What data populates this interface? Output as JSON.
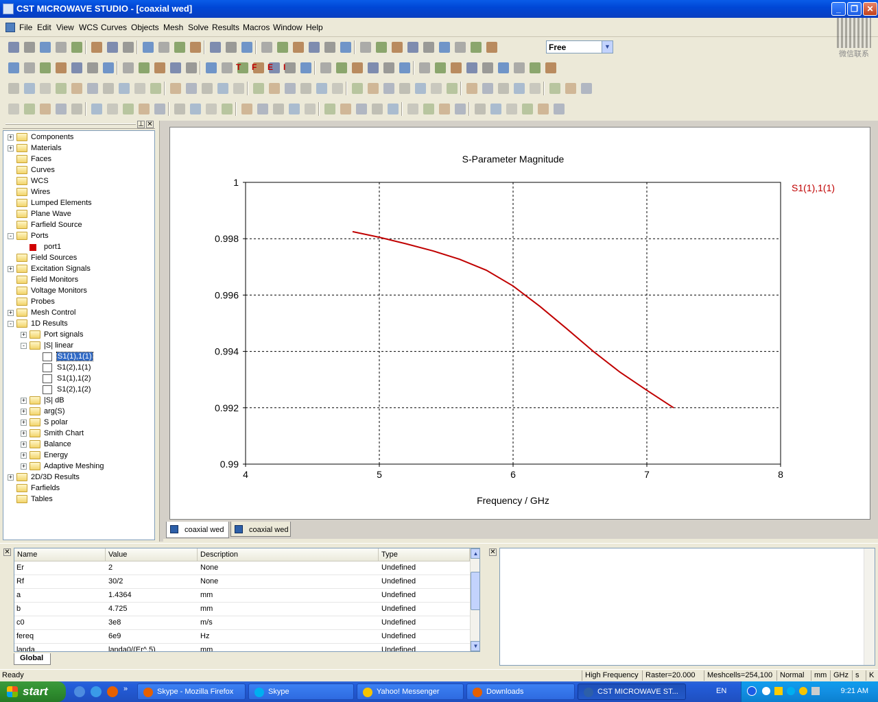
{
  "window": {
    "title": "CST MICROWAVE STUDIO - [coaxial wed]",
    "caption_buttons": [
      "minimize",
      "restore",
      "close"
    ]
  },
  "menu": [
    "File",
    "Edit",
    "View",
    "WCS",
    "Curves",
    "Objects",
    "Mesh",
    "Solve",
    "Results",
    "Macros",
    "Window",
    "Help"
  ],
  "toolbar": {
    "mode_select": "Free",
    "special_labels": [
      "T",
      "F",
      "E",
      "I"
    ]
  },
  "watermark": {
    "text": "微信联系"
  },
  "tree": [
    {
      "label": "Components",
      "level": 0,
      "toggle": "+",
      "icon": "folder"
    },
    {
      "label": "Materials",
      "level": 0,
      "toggle": "+",
      "icon": "folder"
    },
    {
      "label": "Faces",
      "level": 0,
      "toggle": "",
      "icon": "folder"
    },
    {
      "label": "Curves",
      "level": 0,
      "toggle": "",
      "icon": "folder"
    },
    {
      "label": "WCS",
      "level": 0,
      "toggle": "",
      "icon": "folder"
    },
    {
      "label": "Wires",
      "level": 0,
      "toggle": "",
      "icon": "folder"
    },
    {
      "label": "Lumped Elements",
      "level": 0,
      "toggle": "",
      "icon": "folder"
    },
    {
      "label": "Plane Wave",
      "level": 0,
      "toggle": "",
      "icon": "folder"
    },
    {
      "label": "Farfield Source",
      "level": 0,
      "toggle": "",
      "icon": "folder"
    },
    {
      "label": "Ports",
      "level": 0,
      "toggle": "-",
      "icon": "folder"
    },
    {
      "label": "port1",
      "level": 1,
      "toggle": "",
      "icon": "port"
    },
    {
      "label": "Field Sources",
      "level": 0,
      "toggle": "",
      "icon": "folder"
    },
    {
      "label": "Excitation Signals",
      "level": 0,
      "toggle": "+",
      "icon": "folder"
    },
    {
      "label": "Field Monitors",
      "level": 0,
      "toggle": "",
      "icon": "folder"
    },
    {
      "label": "Voltage Monitors",
      "level": 0,
      "toggle": "",
      "icon": "folder"
    },
    {
      "label": "Probes",
      "level": 0,
      "toggle": "",
      "icon": "folder"
    },
    {
      "label": "Mesh Control",
      "level": 0,
      "toggle": "+",
      "icon": "folder"
    },
    {
      "label": "1D Results",
      "level": 0,
      "toggle": "-",
      "icon": "folder"
    },
    {
      "label": "Port signals",
      "level": 1,
      "toggle": "+",
      "icon": "folder"
    },
    {
      "label": "|S| linear",
      "level": 1,
      "toggle": "-",
      "icon": "folder"
    },
    {
      "label": "S1(1),1(1)",
      "level": 2,
      "toggle": "",
      "icon": "leaf",
      "selected": true
    },
    {
      "label": "S1(2),1(1)",
      "level": 2,
      "toggle": "",
      "icon": "leaf"
    },
    {
      "label": "S1(1),1(2)",
      "level": 2,
      "toggle": "",
      "icon": "leaf"
    },
    {
      "label": "S1(2),1(2)",
      "level": 2,
      "toggle": "",
      "icon": "leaf"
    },
    {
      "label": "|S| dB",
      "level": 1,
      "toggle": "+",
      "icon": "folder"
    },
    {
      "label": "arg(S)",
      "level": 1,
      "toggle": "+",
      "icon": "folder"
    },
    {
      "label": "S polar",
      "level": 1,
      "toggle": "+",
      "icon": "folder"
    },
    {
      "label": "Smith Chart",
      "level": 1,
      "toggle": "+",
      "icon": "folder"
    },
    {
      "label": "Balance",
      "level": 1,
      "toggle": "+",
      "icon": "folder"
    },
    {
      "label": "Energy",
      "level": 1,
      "toggle": "+",
      "icon": "folder"
    },
    {
      "label": "Adaptive Meshing",
      "level": 1,
      "toggle": "+",
      "icon": "folder"
    },
    {
      "label": "2D/3D Results",
      "level": 0,
      "toggle": "+",
      "icon": "folder"
    },
    {
      "label": "Farfields",
      "level": 0,
      "toggle": "",
      "icon": "folder"
    },
    {
      "label": "Tables",
      "level": 0,
      "toggle": "",
      "icon": "folder"
    }
  ],
  "chart_data": {
    "type": "line",
    "title": "S-Parameter Magnitude",
    "xlabel": "Frequency / GHz",
    "ylabel": "",
    "xlim": [
      4,
      8
    ],
    "ylim": [
      0.99,
      1
    ],
    "xticks": [
      "4",
      "5",
      "6",
      "7",
      "8"
    ],
    "yticks": [
      "0.99",
      "0.992",
      "0.994",
      "0.996",
      "0.998",
      "1"
    ],
    "grid": true,
    "legend_position": "right",
    "series": [
      {
        "name": "S1(1),1(1)",
        "color": "#c00000",
        "x": [
          4.8,
          5.0,
          5.2,
          5.4,
          5.6,
          5.8,
          6.0,
          6.2,
          6.4,
          6.6,
          6.8,
          7.0,
          7.2
        ],
        "y": [
          0.99825,
          0.99805,
          0.99782,
          0.99757,
          0.99727,
          0.99688,
          0.99632,
          0.9956,
          0.99481,
          0.994,
          0.99326,
          0.99262,
          0.992
        ]
      }
    ]
  },
  "chart_tabs": [
    {
      "label": "coaxial wed",
      "active": true
    },
    {
      "label": "coaxial wed",
      "active": false
    }
  ],
  "parameters": {
    "columns": [
      "Name",
      "Value",
      "Description",
      "Type"
    ],
    "rows": [
      [
        "Er",
        "2",
        "None",
        "Undefined"
      ],
      [
        "Rf",
        "30/2",
        "None",
        "Undefined"
      ],
      [
        "a",
        "1.4364",
        "mm",
        "Undefined"
      ],
      [
        "b",
        "4.725",
        "mm",
        "Undefined"
      ],
      [
        "c0",
        "3e8",
        "m/s",
        "Undefined"
      ],
      [
        "fereq",
        "6e9",
        "Hz",
        "Undefined"
      ],
      [
        "landa",
        "landa0/(Er^.5)",
        "mm",
        "Undefined"
      ]
    ],
    "tab": "Global"
  },
  "status": {
    "ready": "Ready",
    "solver": "High Frequency",
    "raster": "Raster=20.000",
    "meshcells": "Meshcells=254,100",
    "mode": "Normal",
    "length_unit": "mm",
    "freq_unit": "GHz",
    "time_unit": "s",
    "temp_unit": "K"
  },
  "taskbar": {
    "start": "start",
    "tasks": [
      {
        "label": "Skype - Mozilla Firefox",
        "color": "#e66000"
      },
      {
        "label": "Skype",
        "color": "#00aff0"
      },
      {
        "label": "Yahoo! Messenger",
        "color": "#f7c400"
      },
      {
        "label": "Downloads",
        "color": "#e66000"
      },
      {
        "label": "CST MICROWAVE ST...",
        "color": "#2d5fa8",
        "active": true
      }
    ],
    "lang": "EN",
    "clock": "9:21 AM"
  }
}
